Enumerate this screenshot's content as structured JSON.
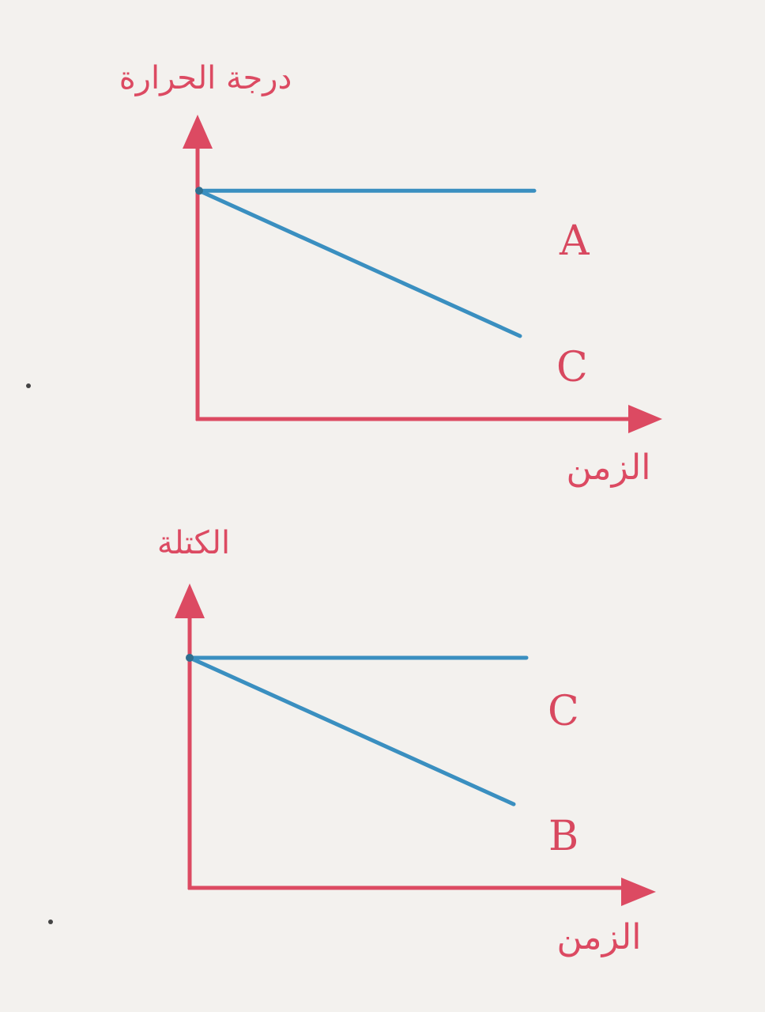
{
  "colors": {
    "axis": "#dc4a62",
    "series_line": "#3a8fc0",
    "background": "#f3f1ee"
  },
  "chart_data": [
    {
      "type": "line",
      "ylabel": "درجة الحرارة",
      "xlabel": "الزمن",
      "grid": false,
      "x": [
        0,
        1
      ],
      "ylim": [
        0,
        1
      ],
      "series": [
        {
          "name": "A",
          "values": [
            0.77,
            0.77
          ]
        },
        {
          "name": "C",
          "values": [
            0.77,
            0.28
          ]
        }
      ]
    },
    {
      "type": "line",
      "ylabel": "الكتلة",
      "xlabel": "الزمن",
      "grid": false,
      "x": [
        0,
        1
      ],
      "ylim": [
        0,
        1
      ],
      "series": [
        {
          "name": "C",
          "values": [
            0.77,
            0.77
          ]
        },
        {
          "name": "B",
          "values": [
            0.77,
            0.28
          ]
        }
      ]
    }
  ]
}
